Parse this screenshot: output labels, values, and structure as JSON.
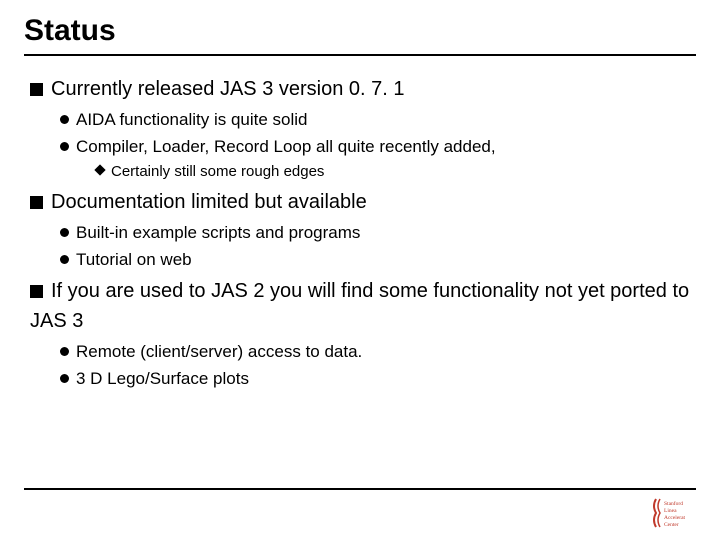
{
  "title": "Status",
  "items": [
    {
      "text": "Currently released JAS 3 version 0. 7. 1",
      "children": [
        {
          "text": "AIDA functionality is quite solid"
        },
        {
          "text": "Compiler, Loader, Record Loop all quite recently added,",
          "children": [
            {
              "text": "Certainly still some rough edges"
            }
          ]
        }
      ]
    },
    {
      "text": "Documentation limited but available",
      "children": [
        {
          "text": "Built-in example scripts and programs"
        },
        {
          "text": "Tutorial on web"
        }
      ]
    },
    {
      "text": "If you are used to JAS 2 you will find some functionality not yet ported to JAS 3",
      "children": [
        {
          "text": "Remote (client/server) access to data."
        },
        {
          "text": "3 D Lego/Surface plots"
        }
      ]
    }
  ],
  "logo": {
    "lines": [
      "Stanford",
      "Linea",
      "Accelerat",
      "Center"
    ],
    "color": "#c0392b"
  }
}
